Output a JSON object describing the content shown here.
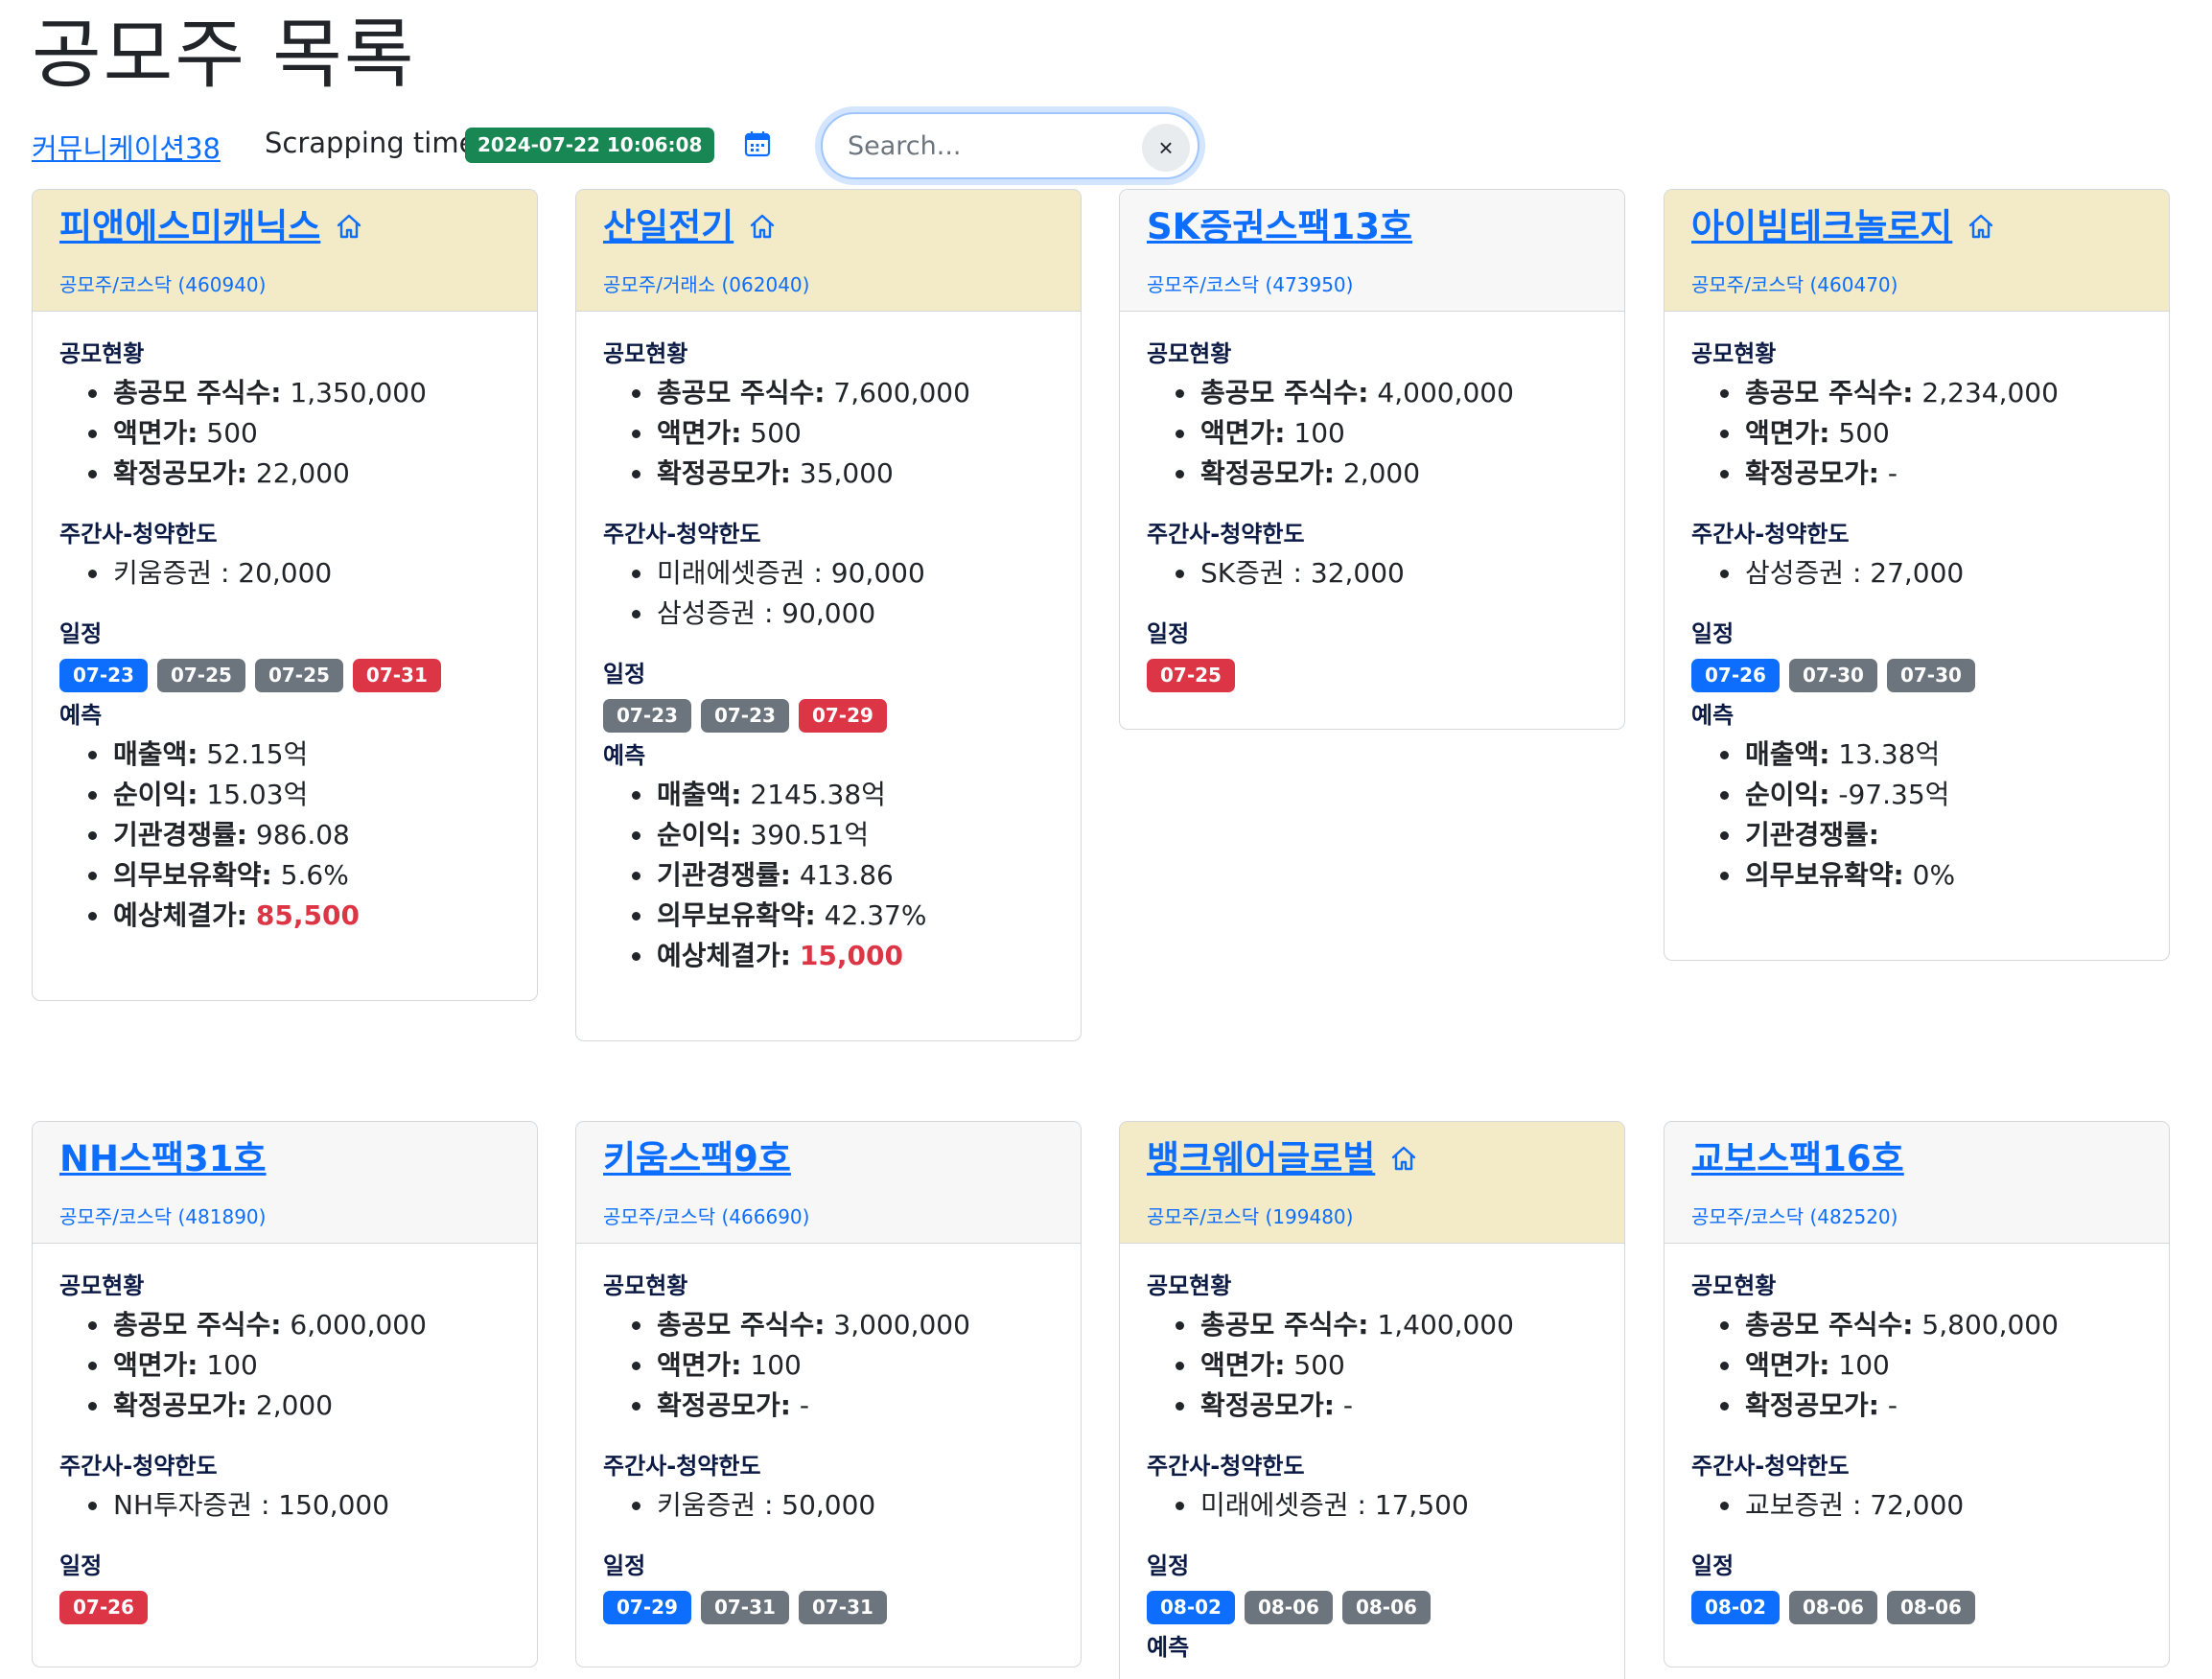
{
  "page": {
    "title": "공모주 목록"
  },
  "toolbar": {
    "company_link": "커뮤니케이션38",
    "scrap_label": "Scrapping time:",
    "scrap_time": "2024-07-22 10:06:08",
    "search_placeholder": "Search...",
    "clear_label": "×"
  },
  "labels": {
    "offering": "공모현황",
    "underwriter": "주간사-청약한도",
    "schedule": "일정",
    "forecast": "예측",
    "total_shares": "총공모 주식수:",
    "par_value": "액면가:",
    "final_price": "확정공모가:",
    "revenue": "매출액:",
    "net_income": "순이익:",
    "inst_comp": "기관경쟁률:",
    "lockup": "의무보유확약:",
    "expected_price": "예상체결가:"
  },
  "colors": {
    "accent": "#0d6efd",
    "highlight_header": "#f3eac7",
    "badge_blue": "#0d6efd",
    "badge_gray": "#6c757d",
    "badge_red": "#dc3545"
  },
  "cards": [
    {
      "name": "피앤에스미캐닉스",
      "home": true,
      "sub": "공모주/코스닥 (460940)",
      "total_shares": " 1,350,000",
      "par_value": " 500",
      "final_price": " 22,000",
      "underwriters": [
        "키움증권 : 20,000"
      ],
      "schedule": [
        {
          "date": "07-23",
          "color": "blue"
        },
        {
          "date": "07-25",
          "color": "gray"
        },
        {
          "date": "07-25",
          "color": "gray"
        },
        {
          "date": "07-31",
          "color": "red"
        }
      ],
      "forecast": {
        "revenue": " 52.15억",
        "net_income": " 15.03억",
        "inst_comp": " 986.08",
        "lockup": " 5.6%",
        "expected_price": "85,500"
      }
    },
    {
      "name": "산일전기",
      "home": true,
      "sub": "공모주/거래소 (062040)",
      "total_shares": " 7,600,000",
      "par_value": " 500",
      "final_price": " 35,000",
      "underwriters": [
        "미래에셋증권 : 90,000",
        "삼성증권 : 90,000"
      ],
      "schedule": [
        {
          "date": "07-23",
          "color": "gray"
        },
        {
          "date": "07-23",
          "color": "gray"
        },
        {
          "date": "07-29",
          "color": "red"
        }
      ],
      "forecast": {
        "revenue": " 2145.38억",
        "net_income": " 390.51억",
        "inst_comp": " 413.86",
        "lockup": " 42.37%",
        "expected_price": "15,000"
      }
    },
    {
      "name": "SK증권스팩13호",
      "home": false,
      "sub": "공모주/코스닥 (473950)",
      "total_shares": " 4,000,000",
      "par_value": " 100",
      "final_price": " 2,000",
      "underwriters": [
        "SK증권 : 32,000"
      ],
      "schedule": [
        {
          "date": "07-25",
          "color": "red"
        }
      ]
    },
    {
      "name": "아이빔테크놀로지",
      "home": true,
      "sub": "공모주/코스닥 (460470)",
      "total_shares": " 2,234,000",
      "par_value": " 500",
      "final_price": " -",
      "underwriters": [
        "삼성증권 : 27,000"
      ],
      "schedule": [
        {
          "date": "07-26",
          "color": "blue"
        },
        {
          "date": "07-30",
          "color": "gray"
        },
        {
          "date": "07-30",
          "color": "gray"
        }
      ],
      "forecast": {
        "revenue": " 13.38억",
        "net_income": " -97.35억",
        "inst_comp": "",
        "lockup": " 0%"
      }
    },
    {
      "name": "NH스팩31호",
      "home": false,
      "sub": "공모주/코스닥 (481890)",
      "total_shares": " 6,000,000",
      "par_value": " 100",
      "final_price": " 2,000",
      "underwriters": [
        "NH투자증권 : 150,000"
      ],
      "schedule": [
        {
          "date": "07-26",
          "color": "red"
        }
      ]
    },
    {
      "name": "키움스팩9호",
      "home": false,
      "sub": "공모주/코스닥 (466690)",
      "total_shares": " 3,000,000",
      "par_value": " 100",
      "final_price": " -",
      "underwriters": [
        "키움증권 : 50,000"
      ],
      "schedule": [
        {
          "date": "07-29",
          "color": "blue"
        },
        {
          "date": "07-31",
          "color": "gray"
        },
        {
          "date": "07-31",
          "color": "gray"
        }
      ]
    },
    {
      "name": "뱅크웨어글로벌",
      "home": true,
      "sub": "공모주/코스닥 (199480)",
      "total_shares": " 1,400,000",
      "par_value": " 500",
      "final_price": " -",
      "underwriters": [
        "미래에셋증권 : 17,500"
      ],
      "schedule": [
        {
          "date": "08-02",
          "color": "blue"
        },
        {
          "date": "08-06",
          "color": "gray"
        },
        {
          "date": "08-06",
          "color": "gray"
        }
      ],
      "forecast_title_only": true
    },
    {
      "name": "교보스팩16호",
      "home": false,
      "sub": "공모주/코스닥 (482520)",
      "total_shares": " 5,800,000",
      "par_value": " 100",
      "final_price": " -",
      "underwriters": [
        "교보증권 : 72,000"
      ],
      "schedule": [
        {
          "date": "08-02",
          "color": "blue"
        },
        {
          "date": "08-06",
          "color": "gray"
        },
        {
          "date": "08-06",
          "color": "gray"
        }
      ]
    }
  ]
}
